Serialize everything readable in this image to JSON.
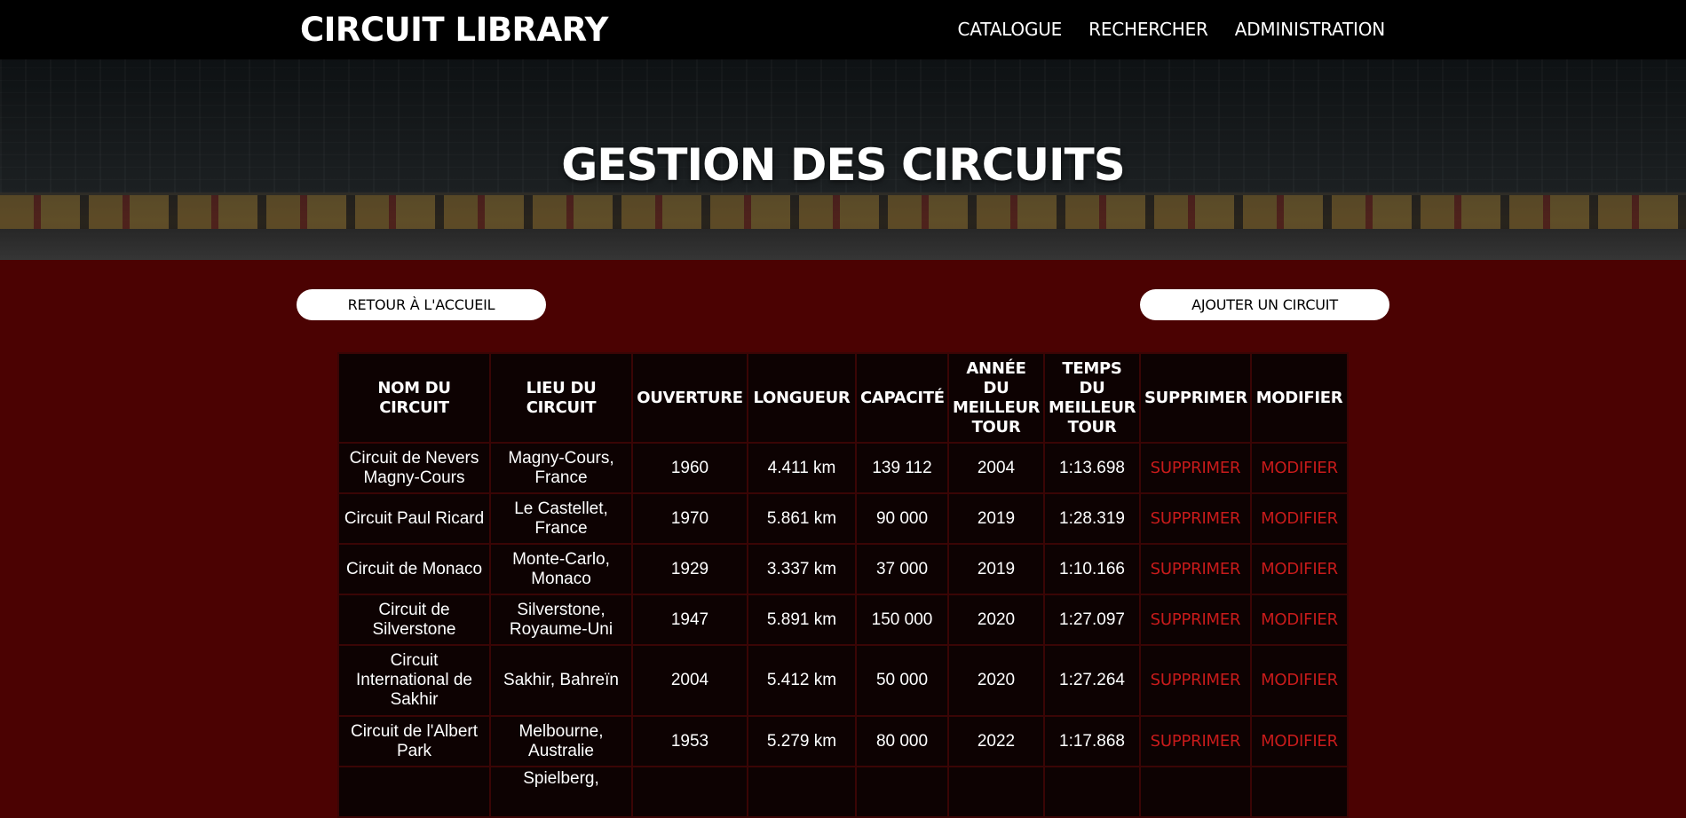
{
  "header": {
    "brand": "CIRCUIT LIBRARY",
    "nav": [
      "CATALOGUE",
      "RECHERCHER",
      "ADMINISTRATION"
    ]
  },
  "hero": {
    "title": "GESTION DES CIRCUITS"
  },
  "actions": {
    "back_label": "RETOUR À L'ACCUEIL",
    "add_label": "AJOUTER UN CIRCUIT"
  },
  "table": {
    "columns": [
      "NOM DU CIRCUIT",
      "LIEU DU CIRCUIT",
      "OUVERTURE",
      "LONGUEUR",
      "CAPACITÉ",
      "ANNÉE DU MEILLEUR TOUR",
      "TEMPS DU MEILLEUR TOUR",
      "SUPPRIMER",
      "MODIFIER"
    ],
    "rows": [
      [
        "Circuit de Nevers Magny-Cours",
        "Magny-Cours, France",
        "1960",
        "4.411 km",
        "139 112",
        "2004",
        "1:13.698",
        "SUPPRIMER",
        "MODIFIER"
      ],
      [
        "Circuit Paul Ricard",
        "Le Castellet, France",
        "1970",
        "5.861 km",
        "90 000",
        "2019",
        "1:28.319",
        "SUPPRIMER",
        "MODIFIER"
      ],
      [
        "Circuit de Monaco",
        "Monte-Carlo, Monaco",
        "1929",
        "3.337 km",
        "37 000",
        "2019",
        "1:10.166",
        "SUPPRIMER",
        "MODIFIER"
      ],
      [
        "Circuit de Silverstone",
        "Silverstone, Royaume-Uni",
        "1947",
        "5.891 km",
        "150 000",
        "2020",
        "1:27.097",
        "SUPPRIMER",
        "MODIFIER"
      ],
      [
        "Circuit International de Sakhir",
        "Sakhir, Bahreïn",
        "2004",
        "5.412 km",
        "50 000",
        "2020",
        "1:27.264",
        "SUPPRIMER",
        "MODIFIER"
      ],
      [
        "Circuit de l'Albert Park",
        "Melbourne, Australie",
        "1953",
        "5.279 km",
        "80 000",
        "2022",
        "1:17.868",
        "SUPPRIMER",
        "MODIFIER"
      ],
      [
        "",
        "Spielberg,",
        "",
        "",
        "",
        "",
        "",
        "",
        ""
      ]
    ]
  },
  "colors": {
    "page_background": "#4b0202",
    "header_background": "#000000",
    "table_cell_background": "#0d0202",
    "action_link": "#c81b1b"
  }
}
